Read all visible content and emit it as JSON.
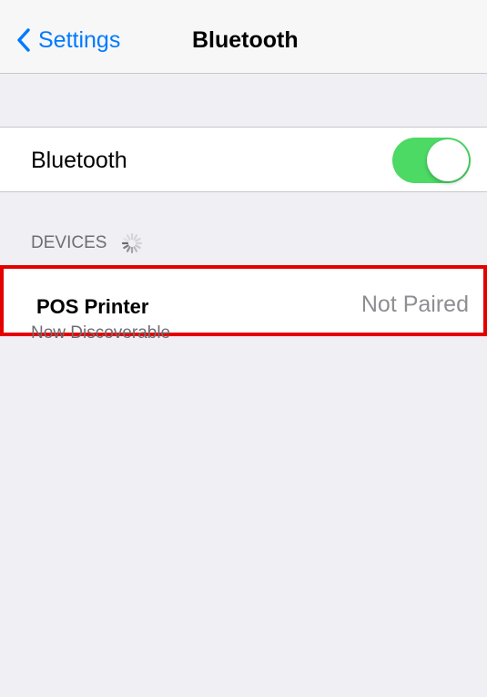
{
  "navbar": {
    "back_label": "Settings",
    "back_icon": "chevron-left-icon",
    "title": "Bluetooth"
  },
  "bluetooth_row": {
    "label": "Bluetooth",
    "toggle_on": true,
    "toggle_color": "#4cd964"
  },
  "devices_section": {
    "header": "DEVICES",
    "spinner_icon": "activity-spinner-icon",
    "devices": [
      {
        "name": "POS Printer",
        "status": "Not Paired",
        "highlight_color": "#e50000"
      }
    ],
    "footer": "Now Discoverable"
  },
  "colors": {
    "accent": "#007aff",
    "background": "#efeff4",
    "secondary_text": "#6d6d72",
    "status_text": "#8e8e93"
  }
}
